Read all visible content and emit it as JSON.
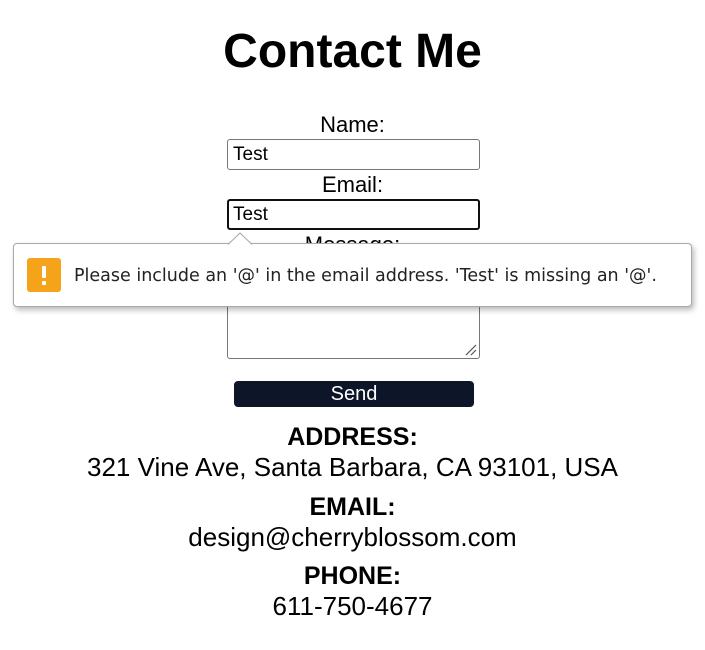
{
  "header": {
    "title": "Contact Me"
  },
  "form": {
    "name_label": "Name:",
    "name_value": "Test",
    "email_label": "Email:",
    "email_value": "Test",
    "message_label": "Message:",
    "message_value": "",
    "send_label": "Send"
  },
  "validation": {
    "message": "Please include an '@' in the email address. 'Test' is missing an '@'.",
    "icon": "warning-icon",
    "icon_color": "#f5a31a"
  },
  "contact_info": {
    "address_heading": "ADDRESS:",
    "address_value": "321 Vine Ave, Santa Barbara, CA 93101, USA",
    "email_heading": "EMAIL:",
    "email_value": "design@cherryblossom.com",
    "phone_heading": "PHONE:",
    "phone_value": "611-750-4677"
  },
  "colors": {
    "send_button_bg": "#0c1628",
    "send_button_text": "#ffffff"
  }
}
